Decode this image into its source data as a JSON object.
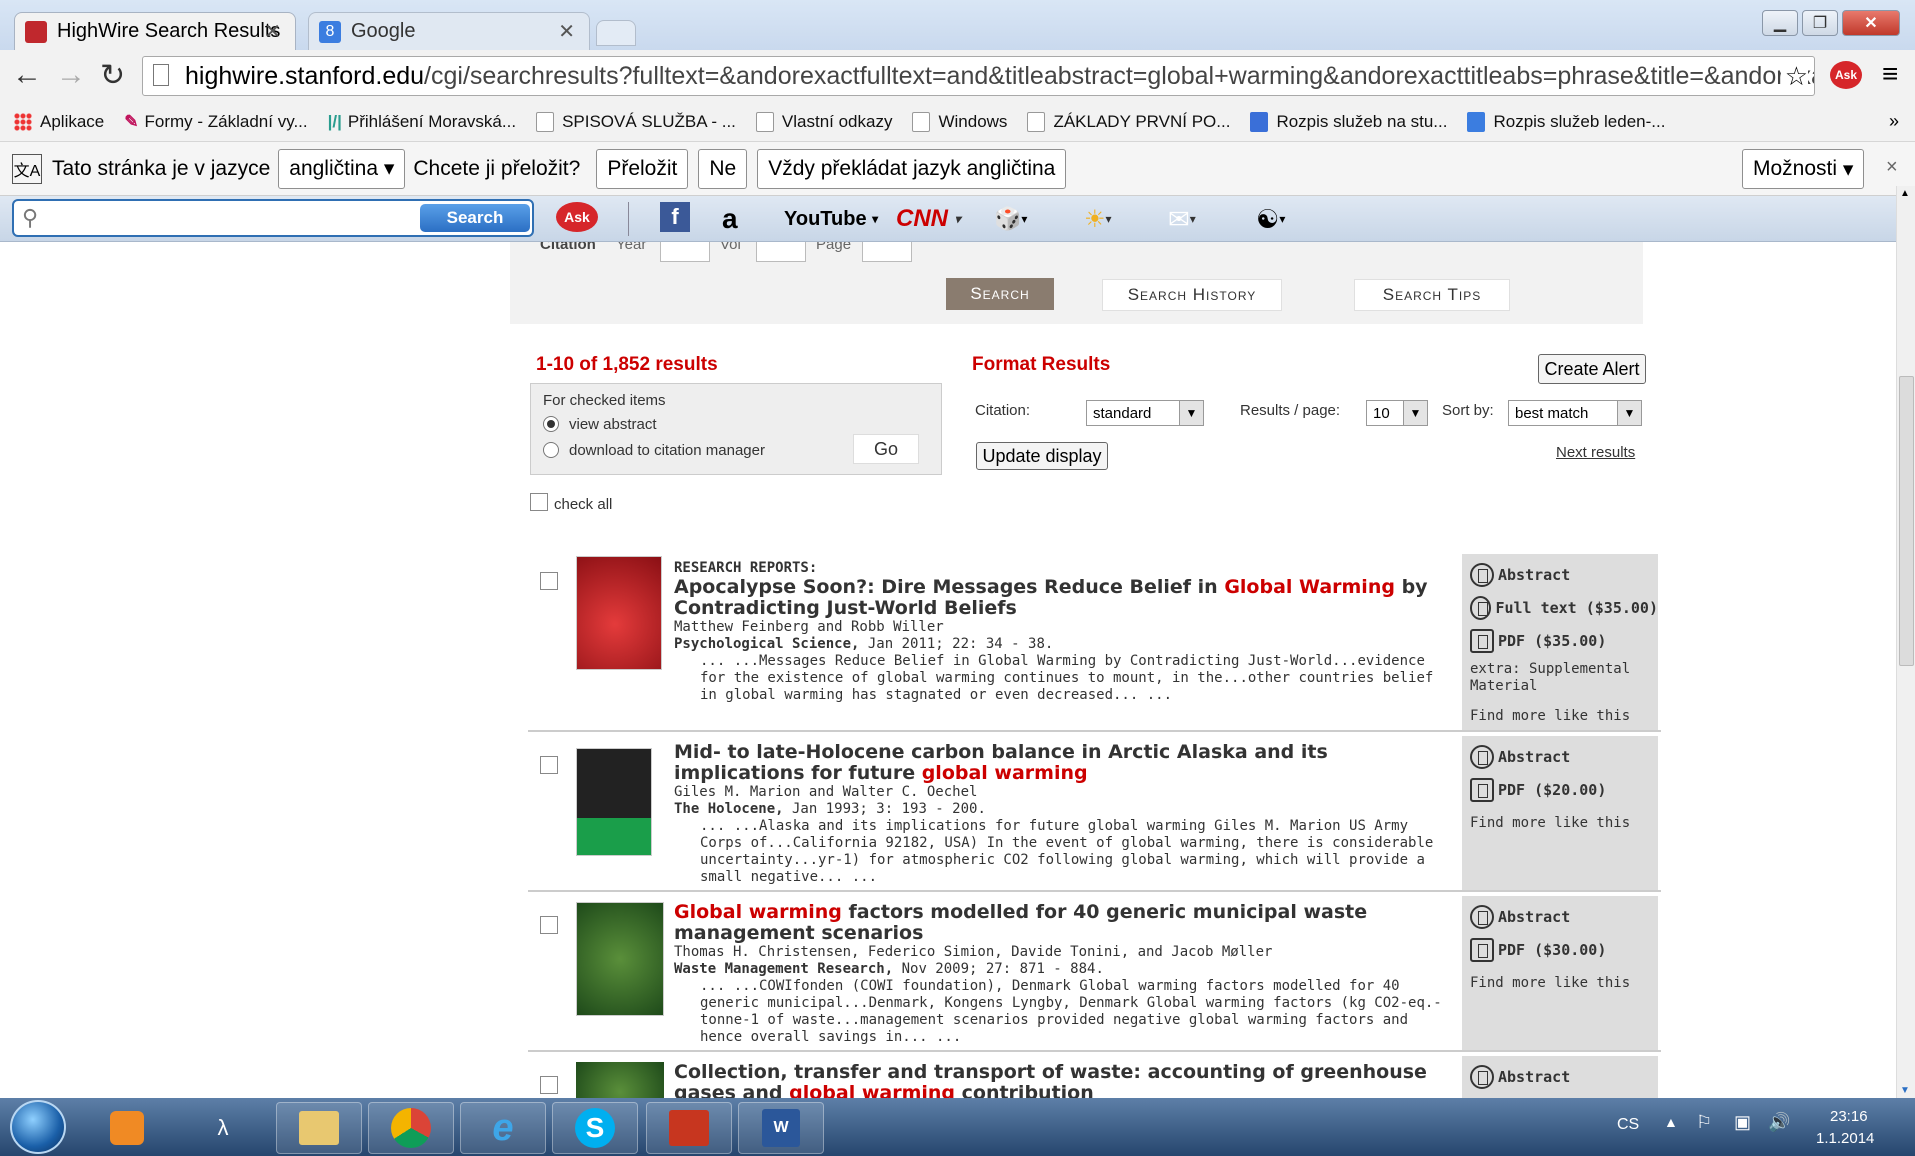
{
  "browser": {
    "tabs": [
      {
        "title": "HighWire Search Results",
        "active": true
      },
      {
        "title": "Google",
        "active": false
      }
    ],
    "url_host": "highwire.stanford.edu",
    "url_path": "/cgi/searchresults?fulltext=&andorexactfulltext=and&titleabstract=global+warming&andorexacttitleabs=phrase&title=&andorexact",
    "bookmarks": [
      "Aplikace",
      "Formy - Základní vy...",
      "Přihlášení Moravská...",
      "SPISOVÁ SLUŽBA - ...",
      "Vlastní odkazy",
      "Windows",
      "ZÁKLADY PRVNÍ PO...",
      "Rozpis služeb na stu...",
      "Rozpis služeb leden-..."
    ],
    "more_bookmarks": "»"
  },
  "translate_bar": {
    "prompt": "Tato stránka je v jazyce",
    "language": "angličtina",
    "question": "Chcete ji přeložit?",
    "translate": "Přeložit",
    "no": "Ne",
    "always": "Vždy překládat jazyk angličtina",
    "options": "Možnosti",
    "close": "×"
  },
  "ask_toolbar": {
    "search_label": "Search",
    "ask_label": "Ask",
    "youtube": "YouTube",
    "cnn": "CNN"
  },
  "search_panel": {
    "citation": "Citation",
    "year": "Year",
    "vol": "Vol",
    "page": "Page",
    "search_btn": "Search",
    "history_btn": "Search History",
    "tips_btn": "Search Tips"
  },
  "results_header": {
    "count": "1-10 of 1,852 results",
    "format_results": "Format Results",
    "create_alert": "Create Alert",
    "for_checked": "For checked items",
    "view_abstract": "view abstract",
    "download": "download to citation manager",
    "go": "Go",
    "check_all": "check all",
    "citation_label": "Citation:",
    "citation_value": "standard",
    "results_per_page_label": "Results / page:",
    "results_per_page_value": "10",
    "sort_label": "Sort by:",
    "sort_value": "best match",
    "update": "Update display",
    "next": "Next results"
  },
  "results": [
    {
      "type_label": "RESEARCH REPORTS:",
      "title_pre": "Apocalypse Soon?: Dire Messages Reduce Belief in ",
      "title_hl": "Global Warming",
      "title_post": " by Contradicting Just-World Beliefs",
      "authors": "Matthew Feinberg and Robb Willer",
      "journal": "Psychological Science,",
      "citation": " Jan 2011; 22: 34 - 38.",
      "snippet": "... ...Messages Reduce Belief in Global Warming by Contradicting Just-World...evidence for the existence of global warming continues to mount, in the...other countries belief in global warming has stagnated or even decreased... ...",
      "links": [
        "Abstract",
        "Full text ($35.00)",
        "PDF ($35.00)",
        "extra: Supplemental Material",
        "Find more like this"
      ]
    },
    {
      "type_label": "",
      "title_pre": "Mid- to late-Holocene carbon balance in Arctic Alaska and its implications for future ",
      "title_hl": "global warming",
      "title_post": "",
      "authors": "Giles M. Marion and Walter C. Oechel",
      "journal": "The Holocene,",
      "citation": " Jan 1993; 3: 193 - 200.",
      "snippet": "... ...Alaska and its implications for future global warming Giles M. Marion US Army Corps of...California 92182, USA) In the event of global warming, there is considerable uncertainty...yr-1) for atmospheric CO2 following global warming, which will provide a small negative... ...",
      "links": [
        "Abstract",
        "PDF ($20.00)",
        "Find more like this"
      ]
    },
    {
      "type_label": "",
      "title_pre": "",
      "title_hl": "Global warming",
      "title_post": " factors modelled for 40 generic municipal waste management scenarios",
      "authors": "Thomas H. Christensen, Federico Simion, Davide Tonini, and Jacob Møller",
      "journal": "Waste Management Research,",
      "citation": " Nov 2009; 27: 871 - 884.",
      "snippet": "... ...COWIfonden (COWI foundation), Denmark Global warming factors modelled for 40 generic municipal...Denmark, Kongens Lyngby, Denmark Global warming factors (kg CO2-eq.-tonne-1 of waste...management scenarios provided negative global warming factors and hence overall savings in... ...",
      "links": [
        "Abstract",
        "PDF ($30.00)",
        "Find more like this"
      ]
    },
    {
      "type_label": "",
      "title_pre": "Collection, transfer and transport of waste: accounting of greenhouse gases and ",
      "title_hl": "global warming",
      "title_post": " contribution",
      "authors": "",
      "journal": "",
      "citation": "",
      "snippet": "",
      "links": [
        "Abstract"
      ]
    }
  ],
  "taskbar": {
    "language": "CS",
    "time": "23:16",
    "date": "1.1.2014"
  },
  "colors": {
    "accent_red": "#c00000",
    "panel_gray": "#f2f2f2"
  }
}
